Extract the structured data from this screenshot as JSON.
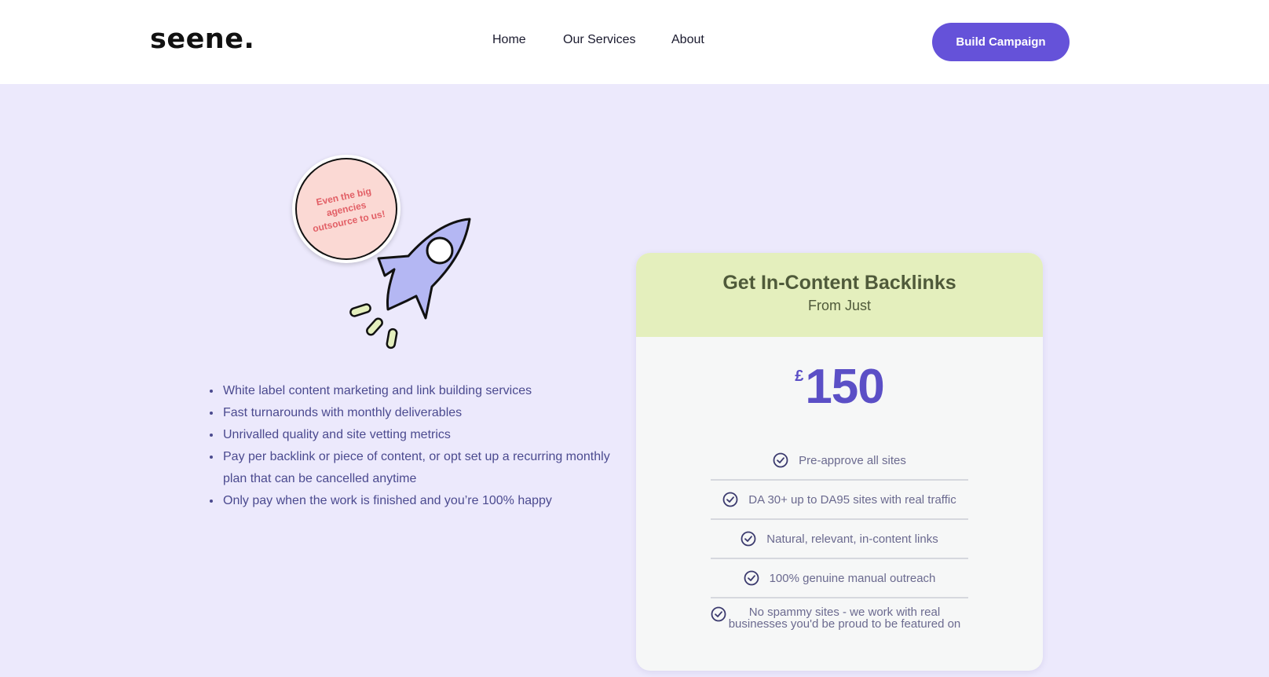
{
  "header": {
    "logo": "seene.",
    "nav": [
      {
        "label": "Home"
      },
      {
        "label": "Our Services"
      },
      {
        "label": "About"
      }
    ],
    "cta_label": "Build Campaign"
  },
  "badge": {
    "text": "Even the big agencies outsource to us!"
  },
  "features": [
    "White label content marketing and link building services",
    "Fast turnarounds with monthly deliverables",
    "Unrivalled quality and site vetting metrics",
    "Pay per backlink or piece of content, or opt set up a recurring monthly plan that can be cancelled anytime",
    "Only pay when the work is finished and you’re 100% happy"
  ],
  "card": {
    "title": "Get In-Content Backlinks",
    "subtitle": "From Just",
    "currency": "£",
    "amount": "150",
    "checklist": [
      "Pre-approve all sites",
      "DA 30+ up to DA95 sites with real traffic",
      "Natural, relevant, in-content links",
      "100% genuine manual outreach",
      "No spammy sites - we work with real businesses you'd be proud to be featured on"
    ]
  },
  "colors": {
    "accent": "#6552d9",
    "hero_background": "#ece9fc",
    "card_header": "#e4efbd",
    "badge_fill": "#fbd9d4",
    "badge_text": "#e25f66",
    "price": "#5b4fc6"
  },
  "icons": [
    "rocket-icon",
    "check-circle-icon"
  ]
}
